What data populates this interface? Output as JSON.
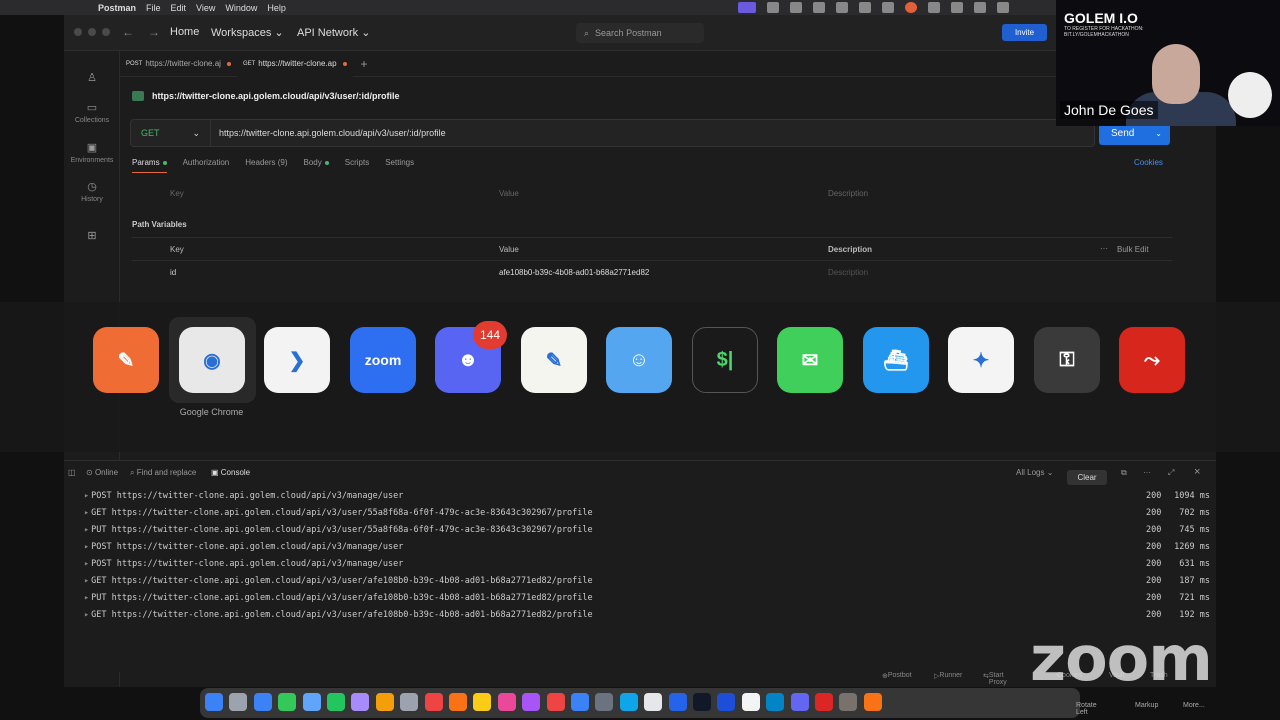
{
  "menubar": {
    "app": "Postman",
    "items": [
      "File",
      "Edit",
      "View",
      "Window",
      "Help"
    ]
  },
  "topbar": {
    "home": "Home",
    "workspaces": "Workspaces",
    "api_network": "API Network",
    "search_placeholder": "Search Postman",
    "invite": "Invite"
  },
  "sidebar": [
    {
      "label": ""
    },
    {
      "label": "Collections"
    },
    {
      "label": "Environments"
    },
    {
      "label": "History"
    },
    {
      "label": ""
    }
  ],
  "tabs": [
    {
      "method": "POST",
      "label": "https://twitter-clone.aj",
      "dot": "orange"
    },
    {
      "method": "GET",
      "label": "https://twitter-clone.ap",
      "dot": "orange"
    }
  ],
  "request": {
    "title": "https://twitter-clone.api.golem.cloud/api/v3/user/:id/profile",
    "method": "GET",
    "url": "https://twitter-clone.api.golem.cloud/api/v3/user/:id/profile",
    "send": "Send",
    "subtabs": [
      "Params",
      "Authorization",
      "Headers (9)",
      "Body",
      "Scripts",
      "Settings"
    ],
    "cookies": "Cookies"
  },
  "query_table": {
    "key": "Key",
    "value": "Value",
    "description": "Description"
  },
  "path_variables": {
    "title": "Path Variables",
    "headers": {
      "key": "Key",
      "value": "Value",
      "description": "Description",
      "bulk_edit": "Bulk Edit"
    },
    "rows": [
      {
        "key": "id",
        "value": "afe108b0-b39c-4b08-ad01-b68a2771ed82",
        "description": "Description"
      }
    ]
  },
  "switcher": {
    "apps": [
      {
        "name": "postman-app-icon",
        "color": "#ef6c35",
        "glyph": "✎"
      },
      {
        "name": "chrome-app-icon",
        "color": "#e8e8e8",
        "glyph": "◉"
      },
      {
        "name": "vscode-app-icon",
        "color": "#f3f3f3",
        "glyph": "❯"
      },
      {
        "name": "zoom-app-icon",
        "color": "#2d6ff0",
        "glyph": "zoom"
      },
      {
        "name": "discord-app-icon",
        "color": "#5865f2",
        "glyph": "☻"
      },
      {
        "name": "textedit-app-icon",
        "color": "#f5f5f0",
        "glyph": "✎"
      },
      {
        "name": "finder-app-icon",
        "color": "#54a6f0",
        "glyph": "☺"
      },
      {
        "name": "terminal-app-icon",
        "color": "#1a1a1a",
        "glyph": "$|"
      },
      {
        "name": "messages-app-icon",
        "color": "#3fcf5a",
        "glyph": "✉"
      },
      {
        "name": "docker-app-icon",
        "color": "#2396ed",
        "glyph": "⛴"
      },
      {
        "name": "safari-app-icon",
        "color": "#f4f4f4",
        "glyph": "✦"
      },
      {
        "name": "keychain-app-icon",
        "color": "#3a3a3a",
        "glyph": "⚿"
      },
      {
        "name": "acrobat-app-icon",
        "color": "#d7261c",
        "glyph": "⤳"
      }
    ],
    "discord_badge": "144",
    "selected_label": "Google Chrome"
  },
  "console": {
    "online": "Online",
    "find_replace": "Find and replace",
    "console": "Console",
    "all_logs": "All Logs",
    "clear": "Clear",
    "logs": [
      {
        "method": "POST",
        "url": "https://twitter-clone.api.golem.cloud/api/v3/manage/user",
        "status": "200",
        "time": "1094 ms"
      },
      {
        "method": "GET",
        "url": "https://twitter-clone.api.golem.cloud/api/v3/user/55a8f68a-6f0f-479c-ac3e-83643c302967/profile",
        "status": "200",
        "time": "702 ms"
      },
      {
        "method": "PUT",
        "url": "https://twitter-clone.api.golem.cloud/api/v3/user/55a8f68a-6f0f-479c-ac3e-83643c302967/profile",
        "status": "200",
        "time": "745 ms"
      },
      {
        "method": "POST",
        "url": "https://twitter-clone.api.golem.cloud/api/v3/manage/user",
        "status": "200",
        "time": "1269 ms"
      },
      {
        "method": "POST",
        "url": "https://twitter-clone.api.golem.cloud/api/v3/manage/user",
        "status": "200",
        "time": "631 ms"
      },
      {
        "method": "GET",
        "url": "https://twitter-clone.api.golem.cloud/api/v3/user/afe108b0-b39c-4b08-ad01-b68a2771ed82/profile",
        "status": "200",
        "time": "187 ms"
      },
      {
        "method": "PUT",
        "url": "https://twitter-clone.api.golem.cloud/api/v3/user/afe108b0-b39c-4b08-ad01-b68a2771ed82/profile",
        "status": "200",
        "time": "721 ms"
      },
      {
        "method": "GET",
        "url": "https://twitter-clone.api.golem.cloud/api/v3/user/afe108b0-b39c-4b08-ad01-b68a2771ed82/profile",
        "status": "200",
        "time": "192 ms"
      }
    ]
  },
  "footer": {
    "postbot": "Postbot",
    "runner": "Runner",
    "start_proxy": "Start Proxy",
    "cookies": "Cookies",
    "vault": "Vault",
    "trash": "Trash",
    "rotate_left": "Rotate Left",
    "markup": "Markup",
    "more": "More..."
  },
  "webcam": {
    "brand": "GOLEM I.O",
    "tagline": "TO REGISTER FOR HACKATHON: BIT.LY/GOLEMHACKATHON",
    "speaker": "John De Goes"
  },
  "zoom_watermark": "zoom"
}
